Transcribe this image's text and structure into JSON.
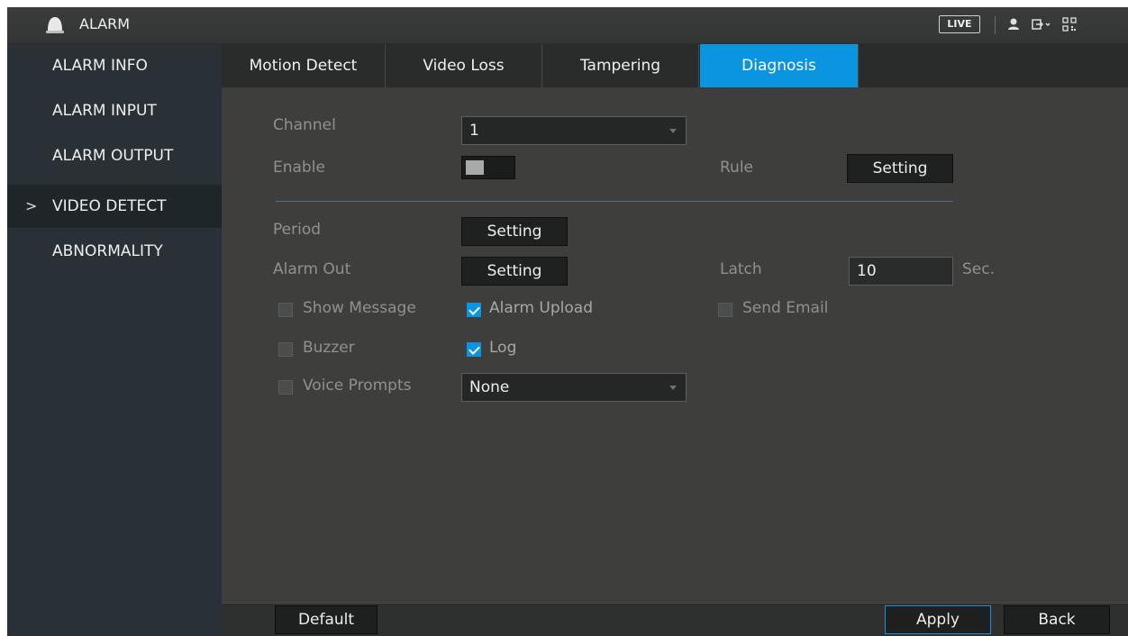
{
  "header": {
    "title": "ALARM",
    "live_label": "LIVE",
    "icons": [
      "alarm-bell-icon",
      "user-icon",
      "logout-icon",
      "qr-code-icon"
    ]
  },
  "sidebar": {
    "items": [
      {
        "label": "ALARM INFO",
        "active": false
      },
      {
        "label": "ALARM INPUT",
        "active": false
      },
      {
        "label": "ALARM OUTPUT",
        "active": false
      },
      {
        "label": "VIDEO DETECT",
        "active": true
      },
      {
        "label": "ABNORMALITY",
        "active": false
      }
    ],
    "active_marker": ">"
  },
  "tabs": [
    {
      "label": "Motion Detect",
      "active": false
    },
    {
      "label": "Video Loss",
      "active": false
    },
    {
      "label": "Tampering",
      "active": false
    },
    {
      "label": "Diagnosis",
      "active": true
    }
  ],
  "form": {
    "channel_label": "Channel",
    "channel_value": "1",
    "enable_label": "Enable",
    "enable_on": false,
    "rule_label": "Rule",
    "rule_button": "Setting",
    "period_label": "Period",
    "period_button": "Setting",
    "alarm_out_label": "Alarm Out",
    "alarm_out_button": "Setting",
    "latch_label": "Latch",
    "latch_value": "10",
    "latch_unit": "Sec.",
    "checkboxes": {
      "show_message": {
        "label": "Show Message",
        "checked": false
      },
      "alarm_upload": {
        "label": "Alarm Upload",
        "checked": true
      },
      "send_email": {
        "label": "Send Email",
        "checked": false
      },
      "buzzer": {
        "label": "Buzzer",
        "checked": false
      },
      "log": {
        "label": "Log",
        "checked": true
      },
      "voice_prompts": {
        "label": "Voice Prompts",
        "checked": false
      }
    },
    "voice_prompts_value": "None"
  },
  "footer": {
    "default_label": "Default",
    "apply_label": "Apply",
    "back_label": "Back"
  },
  "colors": {
    "accent": "#0b95e0",
    "background": "#3e3f3d",
    "sidebar": "#2a3136"
  }
}
